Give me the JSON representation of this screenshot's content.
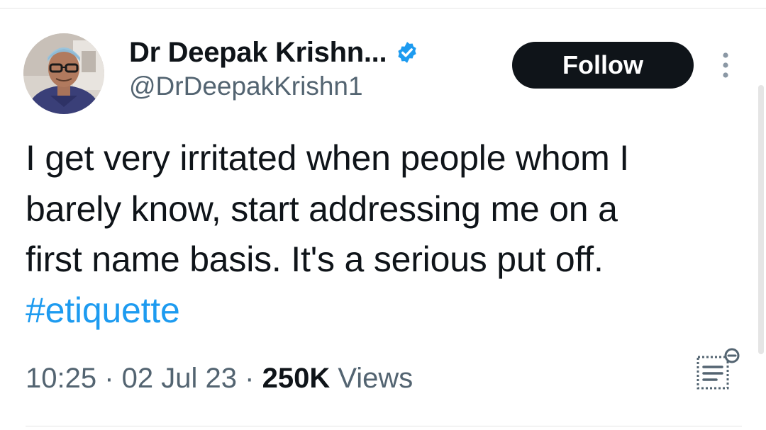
{
  "author": {
    "display_name": "Dr Deepak Krishn...",
    "handle": "@DrDeepakKrishn1",
    "verified": true,
    "verified_color": "#1d9bf0",
    "avatar_icon": "profile-photo"
  },
  "actions": {
    "follow_label": "Follow",
    "more_icon": "more-vertical-icon"
  },
  "tweet": {
    "lines": [
      "I get very irritated when people whom I",
      "barely know, start addressing me on a",
      "first name basis. It's a serious put off."
    ],
    "hashtag": "#etiquette"
  },
  "meta": {
    "time": "10:25",
    "separator": "·",
    "date": "02 Jul 23",
    "views_count": "250K",
    "views_label": "Views",
    "analytics_icon": "post-analytics-icon"
  },
  "colors": {
    "text_primary": "#0f1419",
    "text_secondary": "#536471",
    "link": "#1d9bf0",
    "follow_bg": "#0f1419"
  }
}
